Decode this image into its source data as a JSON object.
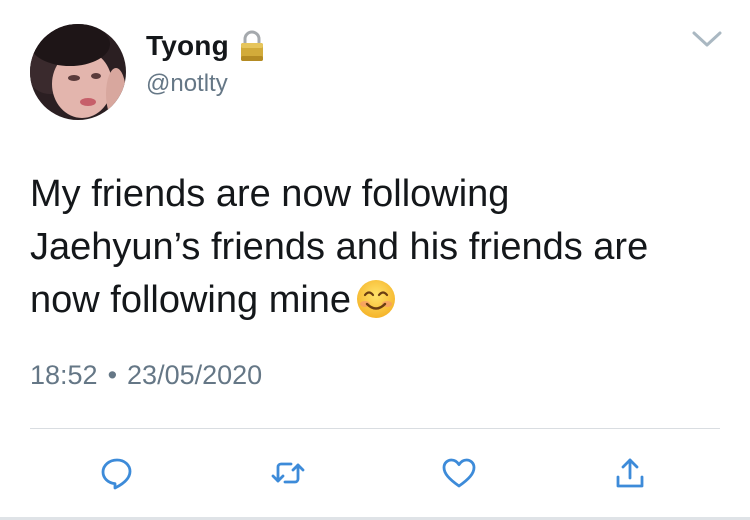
{
  "user": {
    "display_name": "Tyong",
    "handle": "@notlty",
    "protected_icon": "lock-icon",
    "avatar": "avatar-photo"
  },
  "tweet": {
    "line1": "My friends are now following",
    "line2": "Jaehyun’s friends and his friends are",
    "line3": "now following mine",
    "emoji": "smiling-face-emoji",
    "time": "18:52",
    "separator": "•",
    "date": "23/05/2020"
  },
  "actions": [
    {
      "icon": "reply-icon"
    },
    {
      "icon": "retweet-icon"
    },
    {
      "icon": "like-icon"
    },
    {
      "icon": "share-icon"
    }
  ],
  "menu_icon": "chevron-down-icon",
  "colors": {
    "text": "#14171a",
    "secondary": "#657786",
    "divider": "#d9dde1",
    "lock_gold": "#c9a227"
  }
}
